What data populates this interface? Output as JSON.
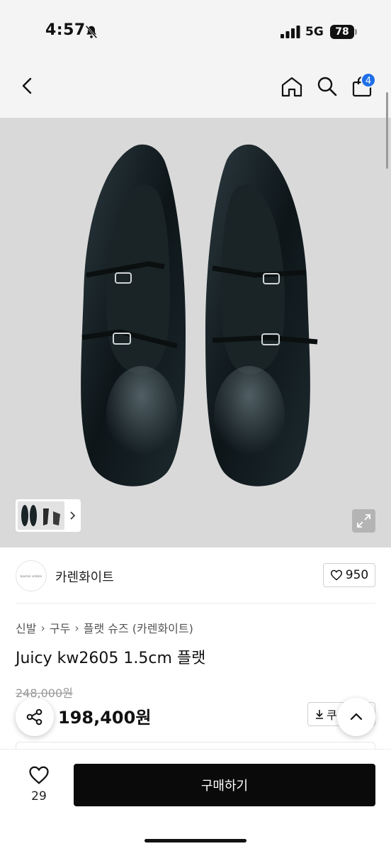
{
  "status_bar": {
    "time": "4:57",
    "network": "5G",
    "battery": "78",
    "icons": [
      "bell-muted-icon",
      "signal-icon"
    ]
  },
  "header": {
    "icons": [
      "back-icon",
      "home-icon",
      "search-icon",
      "bag-icon"
    ],
    "cart_count": "4",
    "badge_color": "#1e6fe8"
  },
  "gallery": {
    "icons": [
      "chevron-right-icon",
      "expand-icon"
    ]
  },
  "shop": {
    "logo_text": "karen white",
    "name": "카렌화이트",
    "like_count": "950"
  },
  "breadcrumb": [
    "신발",
    "구두",
    "플랫 슈즈 (카렌화이트)"
  ],
  "product": {
    "title": "Juicy kw2605 1.5cm 플랫",
    "original_price": "248,000원",
    "sale_price": "198,400원",
    "coupon_label": "쿠"
  },
  "bottom_bar": {
    "wish_count": "29",
    "buy_label": "구매하기",
    "button_color": "#0a0a0a"
  }
}
